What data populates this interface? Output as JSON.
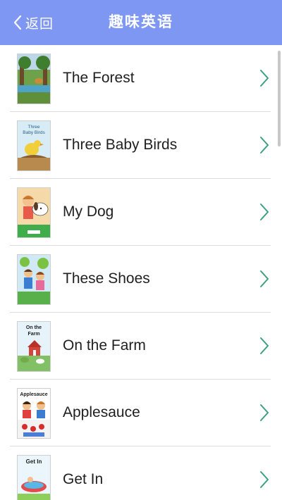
{
  "header": {
    "back_label": "返回",
    "title": "趣味英语",
    "background_color": "#7d97f3"
  },
  "books": {
    "items": [
      {
        "title": "The Forest",
        "cover_text": ""
      },
      {
        "title": "Three Baby Birds",
        "cover_text": "Three Baby Birds"
      },
      {
        "title": "My Dog",
        "cover_text": ""
      },
      {
        "title": "These Shoes",
        "cover_text": ""
      },
      {
        "title": "On the Farm",
        "cover_text": "On the Farm"
      },
      {
        "title": "Applesauce",
        "cover_text": "Applesauce"
      },
      {
        "title": "Get In",
        "cover_text": "Get In"
      }
    ],
    "chevron_icon": "chevron-right-icon",
    "chevron_color": "#3aa07e"
  }
}
